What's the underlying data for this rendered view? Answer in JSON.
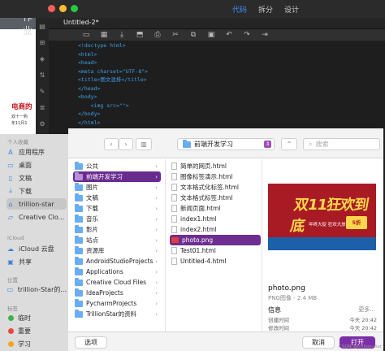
{
  "editor": {
    "title_fragment": "作业",
    "modes": [
      "代码",
      "拆分",
      "设计"
    ],
    "active_mode": "代码",
    "tab_name": "Untitled-2*",
    "code_lines": [
      {
        "pre": "<!doctype html>",
        "kind": "t"
      },
      {
        "pre": "<html>",
        "kind": "t"
      },
      {
        "pre": "<head>",
        "kind": "t"
      },
      {
        "pre": "<meta charset=\"UTF-8\">",
        "kind": "t"
      },
      {
        "pre": "<title>图文混排</title>",
        "kind": "t"
      },
      {
        "pre": "</head>",
        "kind": "t"
      },
      {
        "pre": "",
        "kind": "t"
      },
      {
        "pre": "<body>",
        "kind": "t"
      },
      {
        "pre": "    <img src=\"\">",
        "kind": "t"
      },
      {
        "pre": "</body>",
        "kind": "t"
      },
      {
        "pre": "</html>",
        "kind": "t"
      }
    ]
  },
  "background_page": {
    "headline": "电商的",
    "line1": "双十一购",
    "line2": "年11月1"
  },
  "sidebar": {
    "section_recent": "个人收藏",
    "favorites": [
      {
        "label": "应用程序",
        "icon": "apps-icon"
      },
      {
        "label": "桌面",
        "icon": "desktop-icon"
      },
      {
        "label": "文稿",
        "icon": "documents-icon"
      },
      {
        "label": "下载",
        "icon": "downloads-icon"
      },
      {
        "label": "trillion-star",
        "icon": "home-icon"
      },
      {
        "label": "Creative Clo...",
        "icon": "cloud-files-icon"
      }
    ],
    "section_icloud": "iCloud",
    "icloud": [
      {
        "label": "iCloud 云盘",
        "icon": "icloud-icon"
      },
      {
        "label": "共享",
        "icon": "shared-icon"
      }
    ],
    "section_location": "位置",
    "locations": [
      {
        "label": "trillion-Star的...",
        "icon": "computer-icon"
      }
    ],
    "section_tags": "标签",
    "tags": [
      {
        "label": "临时",
        "color": "#3cb34a"
      },
      {
        "label": "重要",
        "color": "#e5483f"
      },
      {
        "label": "学习",
        "color": "#f4a623"
      }
    ]
  },
  "toolbar": {
    "back": "‹",
    "forward": "›",
    "path": "前端开发学习",
    "search_placeholder": "搜索"
  },
  "column1": [
    {
      "label": "公共",
      "kind": "folder"
    },
    {
      "label": "前端开发学习",
      "kind": "folder",
      "selected": true
    },
    {
      "label": "图片",
      "kind": "folder"
    },
    {
      "label": "文稿",
      "kind": "folder"
    },
    {
      "label": "下载",
      "kind": "folder"
    },
    {
      "label": "音乐",
      "kind": "folder"
    },
    {
      "label": "影片",
      "kind": "folder"
    },
    {
      "label": "站点",
      "kind": "folder"
    },
    {
      "label": "资源库",
      "kind": "folder"
    },
    {
      "label": "AndroidStudioProjects",
      "kind": "folder"
    },
    {
      "label": "Applications",
      "kind": "folder"
    },
    {
      "label": "Creative Cloud Files",
      "kind": "folder"
    },
    {
      "label": "IdeaProjects",
      "kind": "folder"
    },
    {
      "label": "PycharmProjects",
      "kind": "folder"
    },
    {
      "label": "TrillionStar的资料",
      "kind": "folder"
    }
  ],
  "column2": [
    {
      "label": "简单的网页.html"
    },
    {
      "label": "图像标签演示.html"
    },
    {
      "label": "文本格式化标签.html"
    },
    {
      "label": "文本格式标签.html"
    },
    {
      "label": "新闻页面.html"
    },
    {
      "label": "index1.html"
    },
    {
      "label": "index2.html"
    },
    {
      "label": "photo.png",
      "selected": true,
      "thumb": true
    },
    {
      "label": "Test01.html"
    },
    {
      "label": "Untitled-4.html"
    }
  ],
  "preview": {
    "image_title": "双11狂欢到底",
    "image_sub": "年终大促 狂欢大放送",
    "image_badge": "5折",
    "name": "photo.png",
    "meta": "PNG图像 - 2.4 MB",
    "info_label": "信息",
    "more": "更多...",
    "rows": [
      {
        "k": "创建时间",
        "v": "今天 20:42"
      },
      {
        "k": "修改时间",
        "v": "今天 20:42"
      }
    ]
  },
  "buttons": {
    "options": "选项",
    "cancel": "取消",
    "open": "打开"
  },
  "watermark": "CSDN @trillion-star"
}
